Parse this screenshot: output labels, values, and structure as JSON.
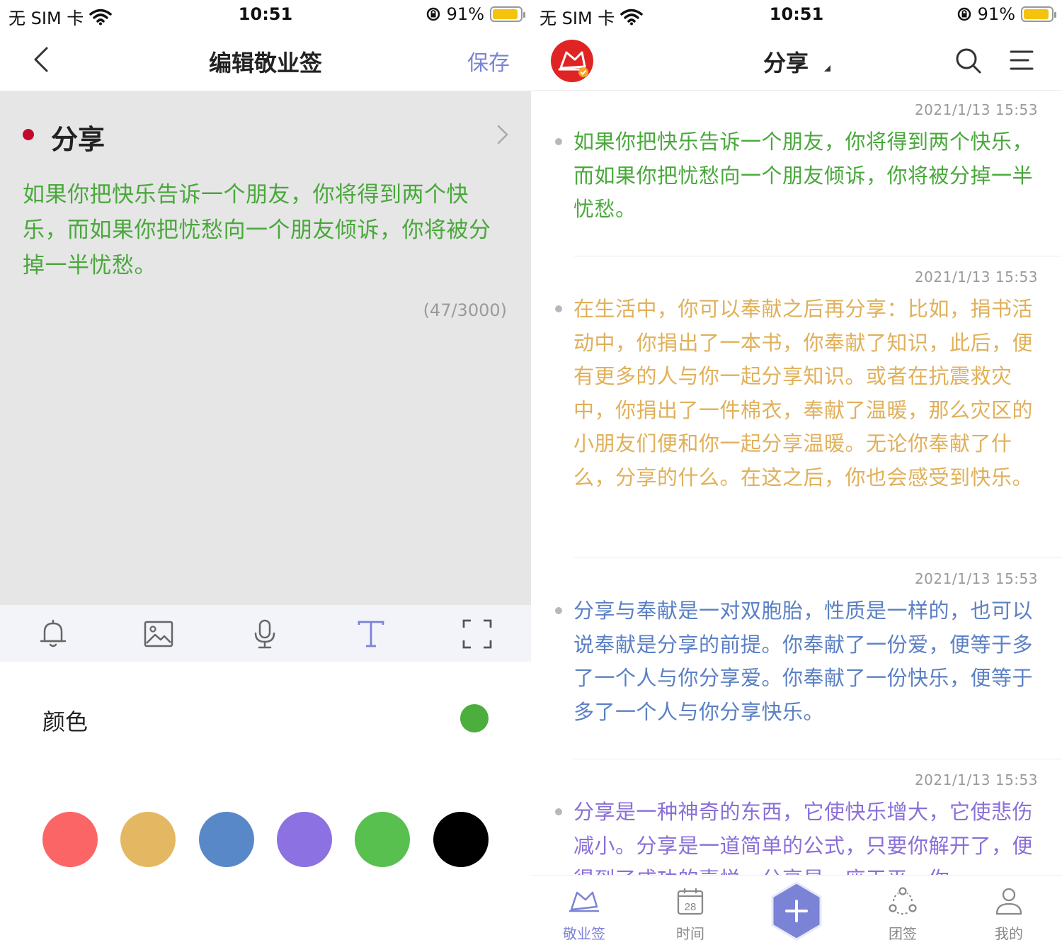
{
  "colors": {
    "accent": "#7b83d6",
    "note_green": "#49a83b",
    "note_yellow": "#e0b05a",
    "note_blue": "#5b80c4",
    "note_purple": "#8a6fd8",
    "category_dot": "#c40a2c",
    "selected_color": "#4cae3c"
  },
  "status_bar": {
    "carrier": "无 SIM 卡",
    "time": "10:51",
    "battery": "91%",
    "battery_level": 0.91
  },
  "editor": {
    "nav_title": "编辑敬业签",
    "save_label": "保存",
    "category": "分享",
    "content": "如果你把快乐告诉一个朋友，你将得到两个快乐，而如果你把忧愁向一个朋友倾诉，你将被分掉一半忧愁。",
    "counter": "(47/3000)",
    "toolbar_icons": [
      "bell-icon",
      "image-icon",
      "microphone-icon",
      "text-format-icon",
      "fullscreen-icon"
    ],
    "color_label": "颜色",
    "swatches": [
      "#fc6565",
      "#e4b862",
      "#5888c8",
      "#8c71e2",
      "#58c04e",
      "#000000"
    ]
  },
  "list": {
    "nav_title": "分享",
    "notes": [
      {
        "timestamp": "2021/1/13 15:53",
        "text": "如果你把快乐告诉一个朋友，你将得到两个快乐，而如果你把忧愁向一个朋友倾诉，你将被分掉一半忧愁。",
        "color": "#49a83b"
      },
      {
        "timestamp": "2021/1/13 15:53",
        "text": "在生活中，你可以奉献之后再分享：比如，捐书活动中，你捐出了一本书，你奉献了知识，此后，便有更多的人与你一起分享知识。或者在抗震救灾中，你捐出了一件棉衣，奉献了温暖，那么灾区的小朋友们便和你一起分享温暖。无论你奉献了什么，分享的什么。在这之后，你也会感受到快乐。",
        "color": "#e0b05a"
      },
      {
        "timestamp": "2021/1/13 15:53",
        "text": "分享与奉献是一对双胞胎，性质是一样的，也可以说奉献是分享的前提。你奉献了一份爱，便等于多了一个人与你分享爱。你奉献了一份快乐，便等于多了一个人与你分享快乐。",
        "color": "#5b80c4"
      },
      {
        "timestamp": "2021/1/13 15:53",
        "text": "分享是一种神奇的东西，它使快乐增大，它使悲伤减小。分享是一道简单的公式，只要你解开了，便得到了成功的喜悦。分享是一座天平，你",
        "color": "#8a6fd8"
      }
    ],
    "tabs": [
      {
        "label": "敬业签",
        "icon": "notes-icon",
        "active": true
      },
      {
        "label": "时间",
        "icon": "calendar-icon",
        "active": false,
        "day": "28"
      },
      {
        "label": "",
        "icon": "add-icon",
        "active": false
      },
      {
        "label": "团签",
        "icon": "team-icon",
        "active": false
      },
      {
        "label": "我的",
        "icon": "profile-icon",
        "active": false
      }
    ]
  }
}
